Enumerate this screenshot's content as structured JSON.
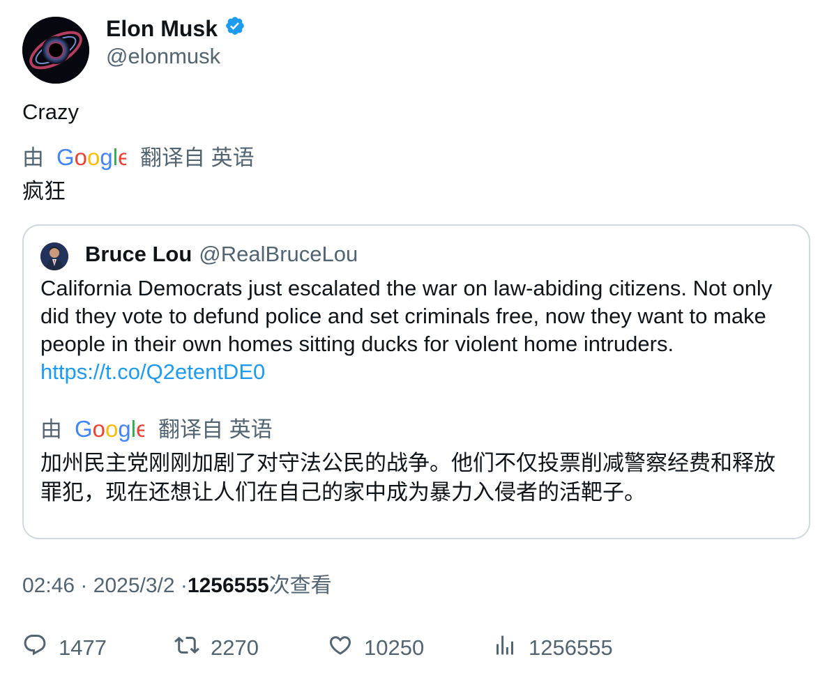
{
  "author": {
    "name": "Elon Musk",
    "handle": "@elonmusk",
    "verified_icon": "verified-badge-icon",
    "verified_color": "#1d9bf0"
  },
  "tweet": {
    "text": "Crazy",
    "translation_prefix": "由",
    "translation_suffix": "翻译自 英语",
    "translated_text": "疯狂"
  },
  "quote": {
    "name": "Bruce Lou",
    "handle": "@RealBruceLou",
    "text": "California Democrats just escalated the war on law-abiding citizens. Not only did they vote to defund police and set criminals free, now they want to make people in their own homes sitting ducks for violent home intruders.",
    "link": "https://t.co/Q2etentDE0",
    "translation_prefix": "由",
    "translation_suffix": "翻译自 英语",
    "translated_text": "加州民主党刚刚加剧了对守法公民的战争。他们不仅投票削减警察经费和释放罪犯，现在还想让人们在自己的家中成为暴力入侵者的活靶子。"
  },
  "meta": {
    "time": "02:46",
    "sep1": "·",
    "date": "2025/3/2",
    "sep2": "·",
    "views_count": "1256555",
    "views_label": "次查看"
  },
  "actions": {
    "replies": "1477",
    "retweets": "2270",
    "likes": "10250",
    "views": "1256555"
  },
  "colors": {
    "link": "#1d9bf0",
    "secondary_text": "#536471",
    "border": "#cfd9de"
  }
}
